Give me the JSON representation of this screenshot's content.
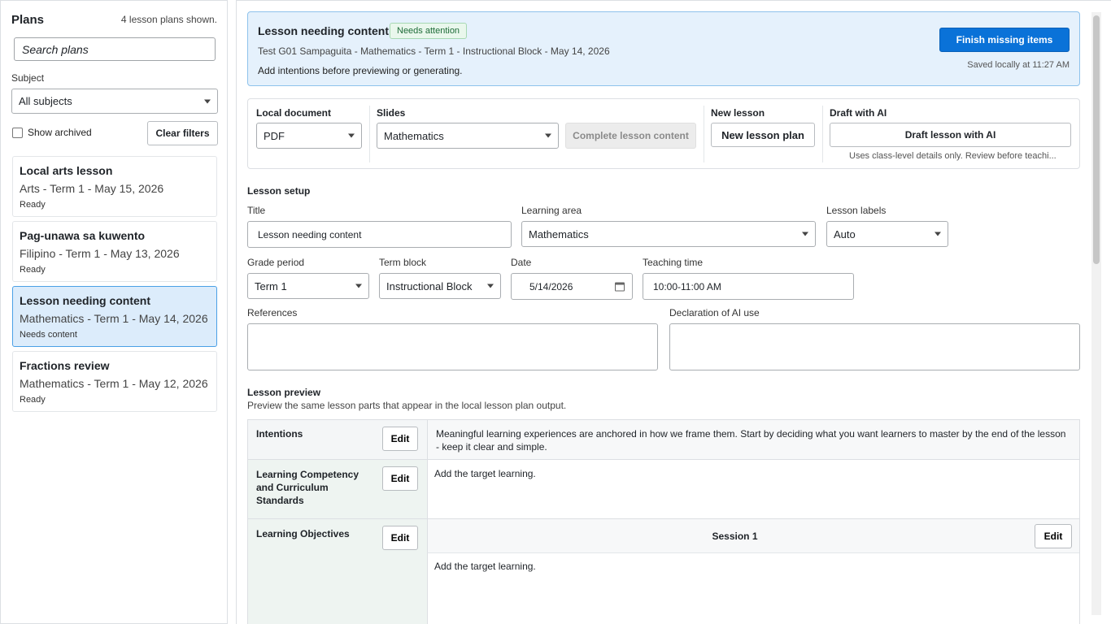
{
  "sidebar": {
    "title": "Plans",
    "count": "4 lesson plans shown.",
    "search_placeholder": "Search plans",
    "subject_label": "Subject",
    "subject_value": "All subjects",
    "show_archived": "Show archived",
    "clear_filters": "Clear filters",
    "plans": [
      {
        "title": "Local arts lesson",
        "meta": "Arts - Term 1 - May 15, 2026",
        "status": "Ready"
      },
      {
        "title": "Pag-unawa sa kuwento",
        "meta": "Filipino - Term 1 - May 13, 2026",
        "status": "Ready"
      },
      {
        "title": "Lesson needing content",
        "meta": "Mathematics - Term 1 - May 14, 2026",
        "status": "Needs content"
      },
      {
        "title": "Fractions review",
        "meta": "Mathematics - Term 1 - May 12, 2026",
        "status": "Ready"
      }
    ]
  },
  "banner": {
    "title": "Lesson needing content",
    "badge": "Needs attention",
    "subtitle": "Test G01 Sampaguita - Mathematics - Term 1 - Instructional Block - May 14, 2026",
    "note": "Add intentions before previewing or generating.",
    "primary_button": "Finish missing items",
    "saved": "Saved locally at 11:27 AM"
  },
  "toolbar": {
    "local_doc_label": "Local document",
    "local_doc_value": "PDF",
    "slides_label": "Slides",
    "slides_value": "Mathematics",
    "complete_button": "Complete lesson content",
    "new_lesson_label": "New lesson",
    "new_lesson_button": "New lesson plan",
    "draft_label": "Draft with AI",
    "draft_button": "Draft lesson with AI",
    "draft_hint": "Uses class-level details only. Review before teachi..."
  },
  "setup": {
    "section_title": "Lesson setup",
    "title_label": "Title",
    "title_value": "Lesson needing content",
    "area_label": "Learning area",
    "area_value": "Mathematics",
    "labels_label": "Lesson labels",
    "labels_value": "Auto",
    "grade_label": "Grade period",
    "grade_value": "Term 1",
    "term_label": "Term block",
    "term_value": "Instructional Block",
    "date_label": "Date",
    "date_value": "5/14/2026",
    "time_label": "Teaching time",
    "time_value": "10:00-11:00 AM",
    "references_label": "References",
    "declaration_label": "Declaration of AI use"
  },
  "preview": {
    "title": "Lesson preview",
    "subtitle": "Preview the same lesson parts that appear in the local lesson plan output.",
    "edit_label": "Edit",
    "rows": [
      {
        "label": "Intentions",
        "content": "Meaningful learning experiences are anchored in how we frame them. Start by deciding what you want learners to master by the end of the lesson - keep it clear and simple."
      },
      {
        "label": "Learning Competency and Curriculum Standards",
        "content": "Add the target learning."
      },
      {
        "label": "Learning Objectives",
        "session": "Session 1",
        "content": "Add the target learning."
      }
    ]
  },
  "colors": {
    "accent": "#0a72d8",
    "banner_bg": "#e5f1fc",
    "active_card": "#dcecfb",
    "badge_green": "#1d6b37"
  }
}
